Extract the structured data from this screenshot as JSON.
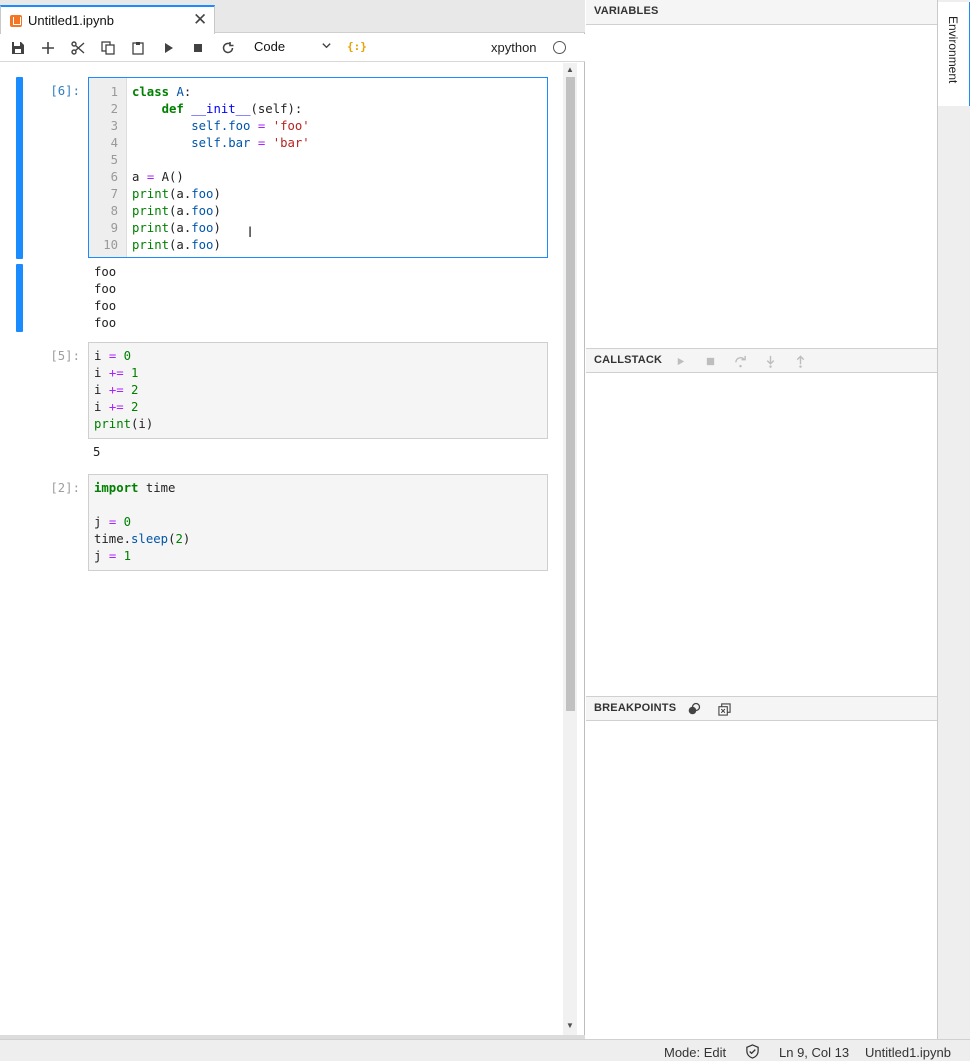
{
  "tab": {
    "title": "Untitled1.ipynb",
    "close": "✕"
  },
  "toolbar": {
    "cell_type": "Code",
    "var_icon": "{:}",
    "kernel": "xpython"
  },
  "cells": [
    {
      "prompt": "[6]:",
      "lines": [
        "1",
        "2",
        "3",
        "4",
        "5",
        "6",
        "7",
        "8",
        "9",
        "10"
      ],
      "output": [
        "foo",
        "foo",
        "foo",
        "foo"
      ]
    },
    {
      "prompt": "[5]:",
      "output": [
        "5"
      ]
    },
    {
      "prompt": "[2]:"
    }
  ],
  "debugger": {
    "variables": "VARIABLES",
    "callstack": "CALLSTACK",
    "breakpoints": "BREAKPOINTS"
  },
  "sidebar": {
    "environment": "Environment"
  },
  "status": {
    "mode": "Mode: Edit",
    "position": "Ln 9, Col 13",
    "file": "Untitled1.ipynb"
  }
}
